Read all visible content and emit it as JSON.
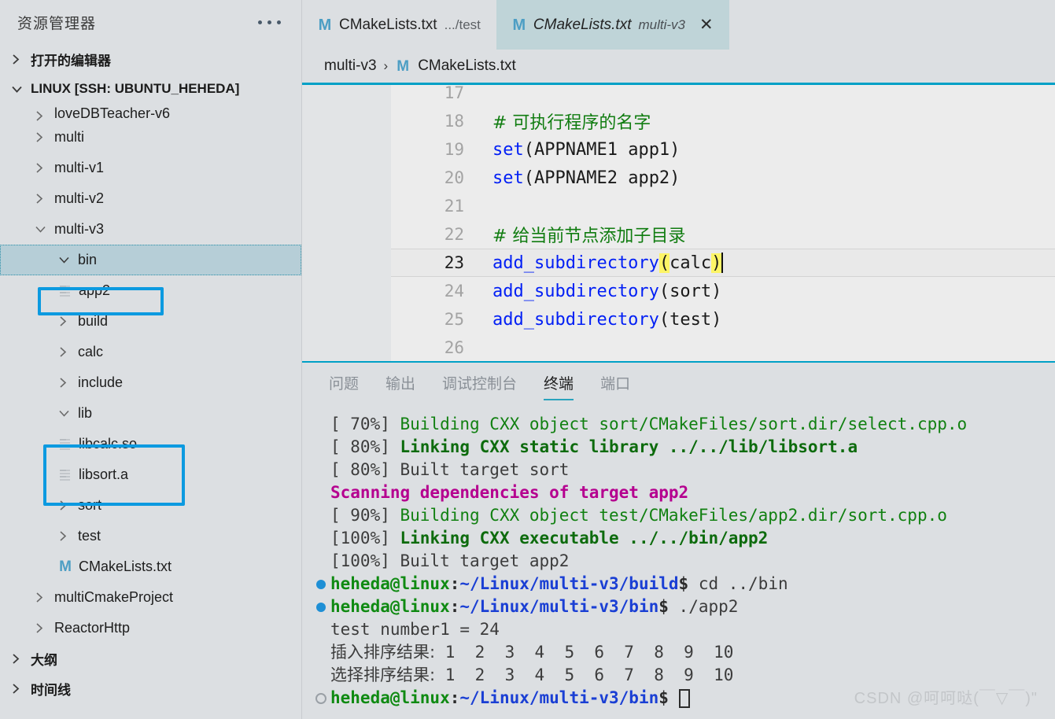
{
  "sidebar": {
    "title": "资源管理器",
    "more_icon": "ellipsis-icon",
    "sections": [
      {
        "label": "打开的编辑器",
        "expanded": false
      },
      {
        "label": "LINUX [SSH: UBUNTU_HEHEDA]",
        "expanded": true
      },
      {
        "label": "大纲",
        "expanded": false
      },
      {
        "label": "时间线",
        "expanded": false
      }
    ],
    "tree": [
      {
        "label": "loveDBTeacher-v6",
        "type": "folder",
        "indent": 1,
        "expanded": false,
        "clipped": true
      },
      {
        "label": "multi",
        "type": "folder",
        "indent": 1,
        "expanded": false
      },
      {
        "label": "multi-v1",
        "type": "folder",
        "indent": 1,
        "expanded": false
      },
      {
        "label": "multi-v2",
        "type": "folder",
        "indent": 1,
        "expanded": false
      },
      {
        "label": "multi-v3",
        "type": "folder",
        "indent": 1,
        "expanded": true
      },
      {
        "label": "bin",
        "type": "folder",
        "indent": 2,
        "expanded": true,
        "selected": true
      },
      {
        "label": "app2",
        "type": "file",
        "indent": 3
      },
      {
        "label": "build",
        "type": "folder",
        "indent": 2,
        "expanded": false
      },
      {
        "label": "calc",
        "type": "folder",
        "indent": 2,
        "expanded": false
      },
      {
        "label": "include",
        "type": "folder",
        "indent": 2,
        "expanded": false
      },
      {
        "label": "lib",
        "type": "folder",
        "indent": 2,
        "expanded": true
      },
      {
        "label": "libcalc.so",
        "type": "file",
        "indent": 3
      },
      {
        "label": "libsort.a",
        "type": "file",
        "indent": 3
      },
      {
        "label": "sort",
        "type": "folder",
        "indent": 2,
        "expanded": false
      },
      {
        "label": "test",
        "type": "folder",
        "indent": 2,
        "expanded": false
      },
      {
        "label": "CMakeLists.txt",
        "type": "cmake",
        "indent": 2
      },
      {
        "label": "multiCmakeProject",
        "type": "folder",
        "indent": 1,
        "expanded": false
      },
      {
        "label": "ReactorHttp",
        "type": "folder",
        "indent": 1,
        "expanded": false
      }
    ],
    "highlight_color": "#0c9ae0"
  },
  "tabs": [
    {
      "icon": "cmake-file-icon",
      "name": "CMakeLists.txt",
      "path": ".../test",
      "active": false,
      "closable": false
    },
    {
      "icon": "cmake-file-icon",
      "name": "CMakeLists.txt",
      "path": "multi-v3",
      "active": true,
      "closable": true,
      "close_label": "✕"
    }
  ],
  "breadcrumb": {
    "root": "multi-v3",
    "separator": "›",
    "icon": "cmake-file-icon",
    "file": "CMakeLists.txt"
  },
  "editor": {
    "lines": [
      {
        "num": "17",
        "segments": []
      },
      {
        "num": "18",
        "segments": [
          {
            "t": "# 可执行程序的名字",
            "c": "cmt"
          }
        ]
      },
      {
        "num": "19",
        "segments": [
          {
            "t": "set",
            "c": "kw"
          },
          {
            "t": "(APPNAME1 app1)",
            "c": "plain"
          }
        ]
      },
      {
        "num": "20",
        "segments": [
          {
            "t": "set",
            "c": "kw"
          },
          {
            "t": "(APPNAME2 app2)",
            "c": "plain"
          }
        ]
      },
      {
        "num": "21",
        "segments": []
      },
      {
        "num": "22",
        "segments": [
          {
            "t": "# 给当前节点添加子目录",
            "c": "cmt"
          }
        ]
      },
      {
        "num": "23",
        "current": true,
        "segments": [
          {
            "t": "add_subdirectory",
            "c": "fn"
          },
          {
            "t": "(",
            "c": "brmatch"
          },
          {
            "t": "calc",
            "c": "plain"
          },
          {
            "t": ")",
            "c": "brmatch"
          },
          {
            "t": "|",
            "c": "caret"
          }
        ]
      },
      {
        "num": "24",
        "segments": [
          {
            "t": "add_subdirectory",
            "c": "fn"
          },
          {
            "t": "(sort)",
            "c": "plain"
          }
        ]
      },
      {
        "num": "25",
        "segments": [
          {
            "t": "add_subdirectory",
            "c": "fn"
          },
          {
            "t": "(test)",
            "c": "plain"
          }
        ]
      },
      {
        "num": "26",
        "segments": []
      }
    ],
    "accent_color": "#00a0c6",
    "keyword_color": "#0320f5",
    "comment_color": "#107c10",
    "bracket_match_color": "#fdf566"
  },
  "panel": {
    "tabs": [
      {
        "label": "问题",
        "active": false
      },
      {
        "label": "输出",
        "active": false
      },
      {
        "label": "调试控制台",
        "active": false
      },
      {
        "label": "终端",
        "active": true
      },
      {
        "label": "端口",
        "active": false
      }
    ],
    "terminal": [
      {
        "mark": "",
        "segments": [
          {
            "t": "[ 70%] ",
            "c": "plain"
          },
          {
            "t": "Building CXX object sort/CMakeFiles/sort.dir/select.cpp.o",
            "c": "g"
          }
        ]
      },
      {
        "mark": "",
        "segments": [
          {
            "t": "[ 80%] ",
            "c": "plain"
          },
          {
            "t": "Linking CXX static library ../../lib/libsort.a",
            "c": "gb"
          }
        ]
      },
      {
        "mark": "",
        "segments": [
          {
            "t": "[ 80%] Built target sort",
            "c": "plain"
          }
        ]
      },
      {
        "mark": "",
        "segments": [
          {
            "t": "Scanning dependencies of target app2",
            "c": "mag"
          }
        ]
      },
      {
        "mark": "",
        "segments": [
          {
            "t": "[ 90%] ",
            "c": "plain"
          },
          {
            "t": "Building CXX object test/CMakeFiles/app2.dir/sort.cpp.o",
            "c": "g"
          }
        ]
      },
      {
        "mark": "",
        "segments": [
          {
            "t": "[100%] ",
            "c": "plain"
          },
          {
            "t": "Linking CXX executable ../../bin/app2",
            "c": "gb"
          }
        ]
      },
      {
        "mark": "",
        "segments": [
          {
            "t": "[100%] Built target app2",
            "c": "plain"
          }
        ]
      },
      {
        "mark": "filled",
        "segments": [
          {
            "t": "heheda@linux",
            "c": "puser"
          },
          {
            "t": ":",
            "c": "pdollar"
          },
          {
            "t": "~/Linux/multi-v3/build",
            "c": "ppath"
          },
          {
            "t": "$ ",
            "c": "pdollar"
          },
          {
            "t": "cd ../bin",
            "c": "pcmd"
          }
        ]
      },
      {
        "mark": "filled",
        "segments": [
          {
            "t": "heheda@linux",
            "c": "puser"
          },
          {
            "t": ":",
            "c": "pdollar"
          },
          {
            "t": "~/Linux/multi-v3/bin",
            "c": "ppath"
          },
          {
            "t": "$ ",
            "c": "pdollar"
          },
          {
            "t": "./app2",
            "c": "pcmd"
          }
        ]
      },
      {
        "mark": "",
        "segments": [
          {
            "t": "test number1 = 24",
            "c": "plain"
          }
        ]
      },
      {
        "mark": "",
        "segments": [
          {
            "t": "插入排序结果:",
            "c": "plain cjk"
          },
          {
            "t": " 1  2  3  4  5  6  7  8  9  10",
            "c": "plain"
          }
        ]
      },
      {
        "mark": "",
        "segments": [
          {
            "t": "选择排序结果:",
            "c": "plain cjk"
          },
          {
            "t": " 1  2  3  4  5  6  7  8  9  10",
            "c": "plain"
          }
        ]
      },
      {
        "mark": "hollow",
        "segments": [
          {
            "t": "heheda@linux",
            "c": "puser"
          },
          {
            "t": ":",
            "c": "pdollar"
          },
          {
            "t": "~/Linux/multi-v3/bin",
            "c": "ppath"
          },
          {
            "t": "$ ",
            "c": "pdollar"
          },
          {
            "t": "▯",
            "c": "blockcur"
          }
        ]
      }
    ]
  },
  "watermark": "CSDN @呵呵哒(￣▽￣)\""
}
